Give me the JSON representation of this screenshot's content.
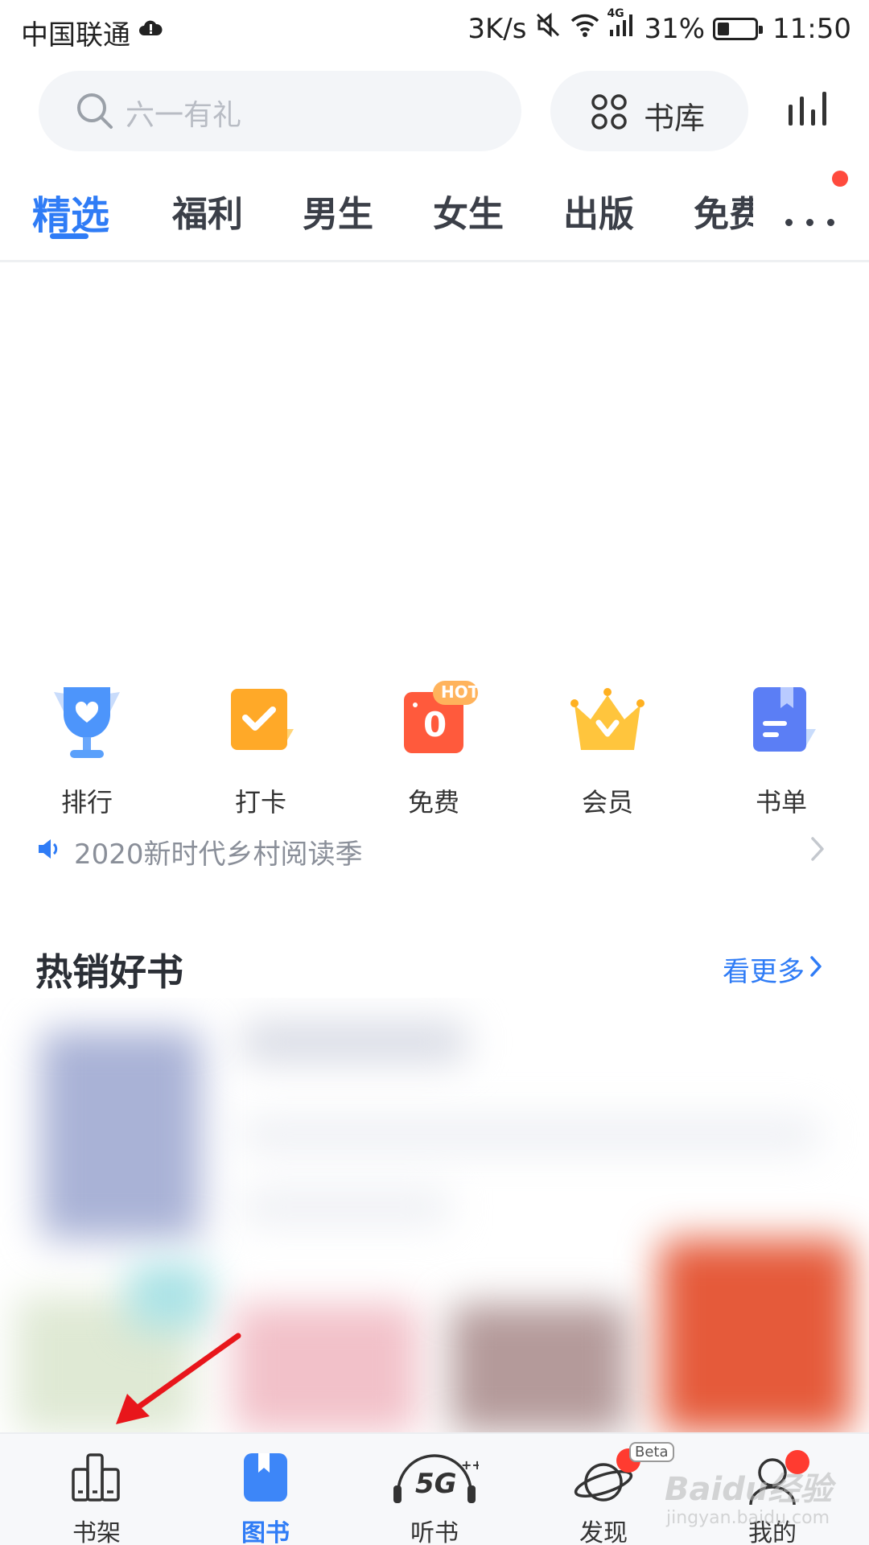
{
  "status_bar": {
    "carrier": "中国联通",
    "net_speed": "3K/s",
    "network_type": "4G",
    "battery": "31%",
    "battery_level": 0.31,
    "time": "11:50"
  },
  "header": {
    "search_placeholder": "六一有礼",
    "library_label": "书库"
  },
  "tabs": [
    {
      "label": "精选",
      "active": true
    },
    {
      "label": "福利"
    },
    {
      "label": "男生"
    },
    {
      "label": "女生"
    },
    {
      "label": "出版"
    },
    {
      "label": "免费"
    }
  ],
  "quick_entries": [
    {
      "label": "排行",
      "icon": "trophy-icon"
    },
    {
      "label": "打卡",
      "icon": "checkin-icon"
    },
    {
      "label": "免费",
      "icon": "free-icon",
      "badge": "HOT",
      "digit": "0"
    },
    {
      "label": "会员",
      "icon": "crown-icon"
    },
    {
      "label": "书单",
      "icon": "booklist-icon"
    }
  ],
  "notice": {
    "text": "2020新时代乡村阅读季"
  },
  "hot_section": {
    "title": "热销好书",
    "more_label": "看更多"
  },
  "bottom_nav": [
    {
      "label": "书架",
      "icon": "bookshelf-icon"
    },
    {
      "label": "图书",
      "icon": "books-icon",
      "active": true
    },
    {
      "label": "听书",
      "icon": "audiobook-5g-icon",
      "icon_text": "5G"
    },
    {
      "label": "发现",
      "icon": "planet-icon",
      "tag": "Beta"
    },
    {
      "label": "我的",
      "icon": "profile-icon"
    }
  ],
  "watermark": {
    "text": "Baidu经验",
    "sub": "jingyan.baidu.com"
  },
  "colors": {
    "accent": "#2f7cf6",
    "badge_red": "#ff3b30",
    "annotation_arrow": "#e8161b"
  }
}
